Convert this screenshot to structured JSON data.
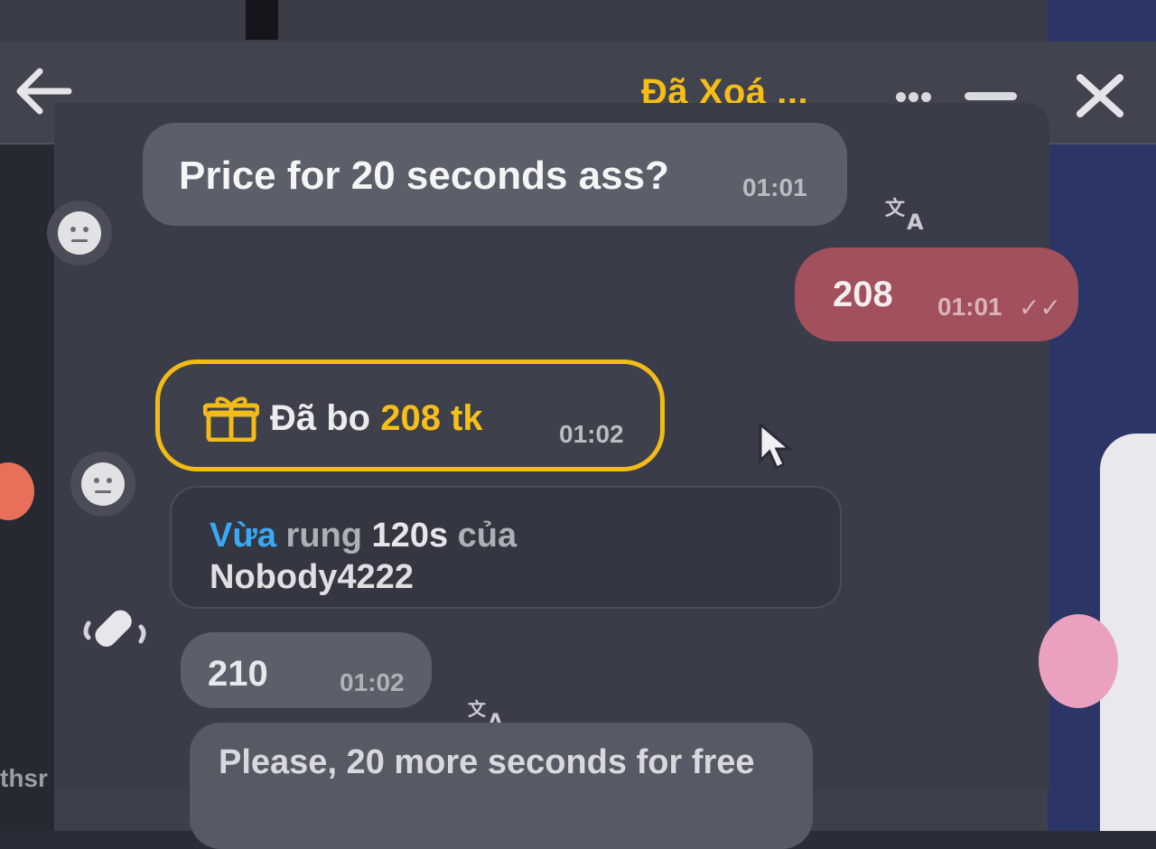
{
  "header": {
    "title": "Đã Xoá ..."
  },
  "messages": {
    "m1": {
      "text": "Price for 20 seconds ass?",
      "time": "01:01"
    },
    "m2": {
      "text": "208",
      "time": "01:01",
      "status": "✓✓"
    },
    "gift": {
      "label": "Đã bo ",
      "amount": "208 tk",
      "time": "01:02"
    },
    "vibrate": {
      "verb": "Vừa",
      "rest1": " rung ",
      "duration": "120s",
      "rest2": " của",
      "user": "Nobody4222"
    },
    "m3": {
      "text": "210",
      "time": "01:02"
    },
    "m4": {
      "text": "Please, 20 more seconds for free"
    }
  },
  "side": {
    "left_text": "thsr"
  },
  "colors": {
    "accent": "#f4bd17",
    "outgoing_bubble": "#a2505c",
    "incoming_bubble": "#5b5f6a",
    "highlight_blue": "#3aa8f2"
  },
  "icons": [
    "back-arrow-icon",
    "more-dots-icon",
    "minimize-icon",
    "close-icon",
    "translate-icon",
    "gift-icon",
    "vibrate-icon",
    "avatar-icon",
    "cursor-icon"
  ]
}
